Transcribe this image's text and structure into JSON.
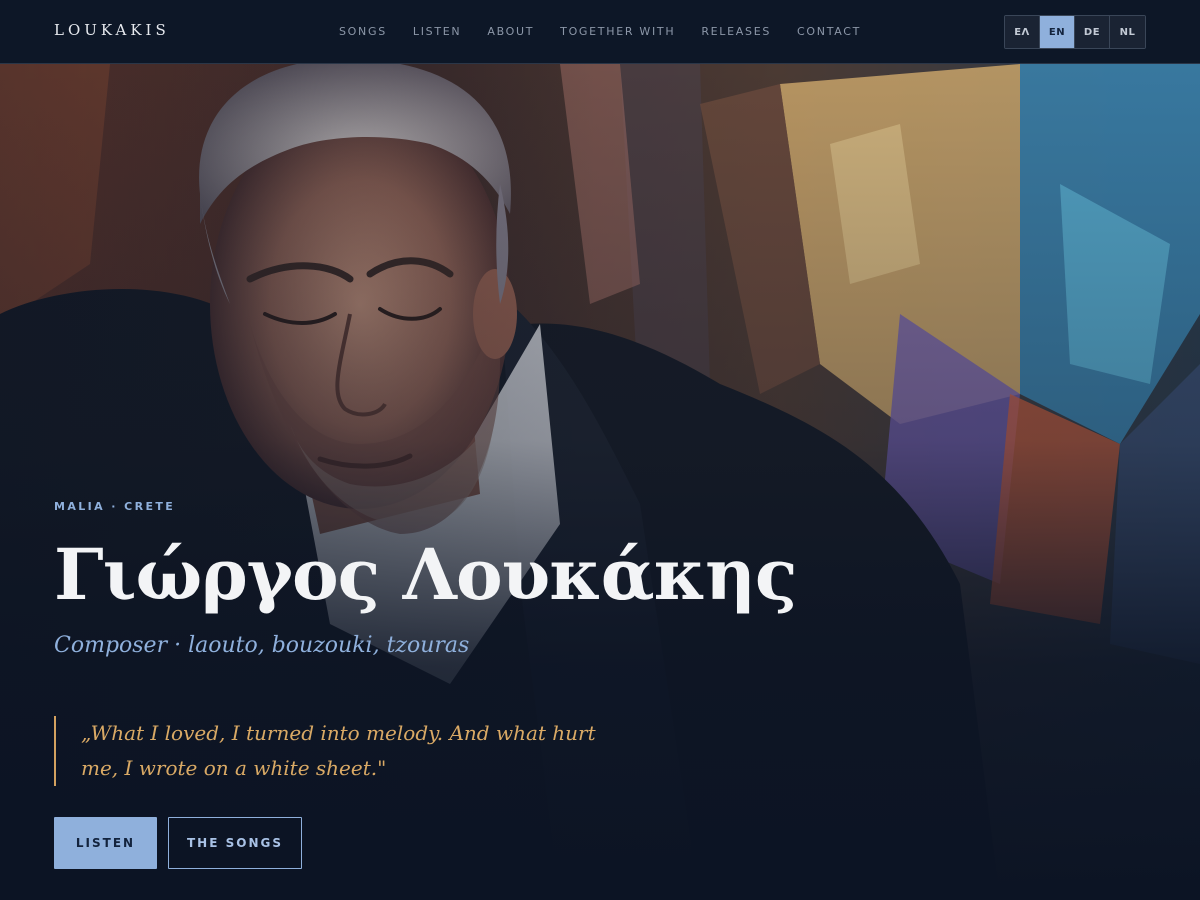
{
  "header": {
    "logo": "LOUKAKIS",
    "nav": [
      {
        "label": "SONGS"
      },
      {
        "label": "LISTEN"
      },
      {
        "label": "ABOUT"
      },
      {
        "label": "TOGETHER WITH"
      },
      {
        "label": "RELEASES"
      },
      {
        "label": "CONTACT"
      }
    ],
    "languages": [
      {
        "code": "ΕΛ",
        "active": false
      },
      {
        "code": "EN",
        "active": true
      },
      {
        "code": "DE",
        "active": false
      },
      {
        "code": "NL",
        "active": false
      }
    ]
  },
  "hero": {
    "location": "MALIA · CRETE",
    "name": "Γιώργος Λουκάκης",
    "subtitle": "Composer · laouto, bouzouki, tzouras",
    "quote": "„What I loved, I turned into melody. And what hurt me, I wrote on a white sheet.\"",
    "buttons": {
      "listen": "LISTEN",
      "songs": "THE SONGS"
    },
    "image": "portrait-photo"
  },
  "colors": {
    "background": "#0c1424",
    "accent": "#8fb0dc",
    "quote": "#d9a965",
    "quote_border": "#d3a15f",
    "text": "#f3f4f6"
  }
}
